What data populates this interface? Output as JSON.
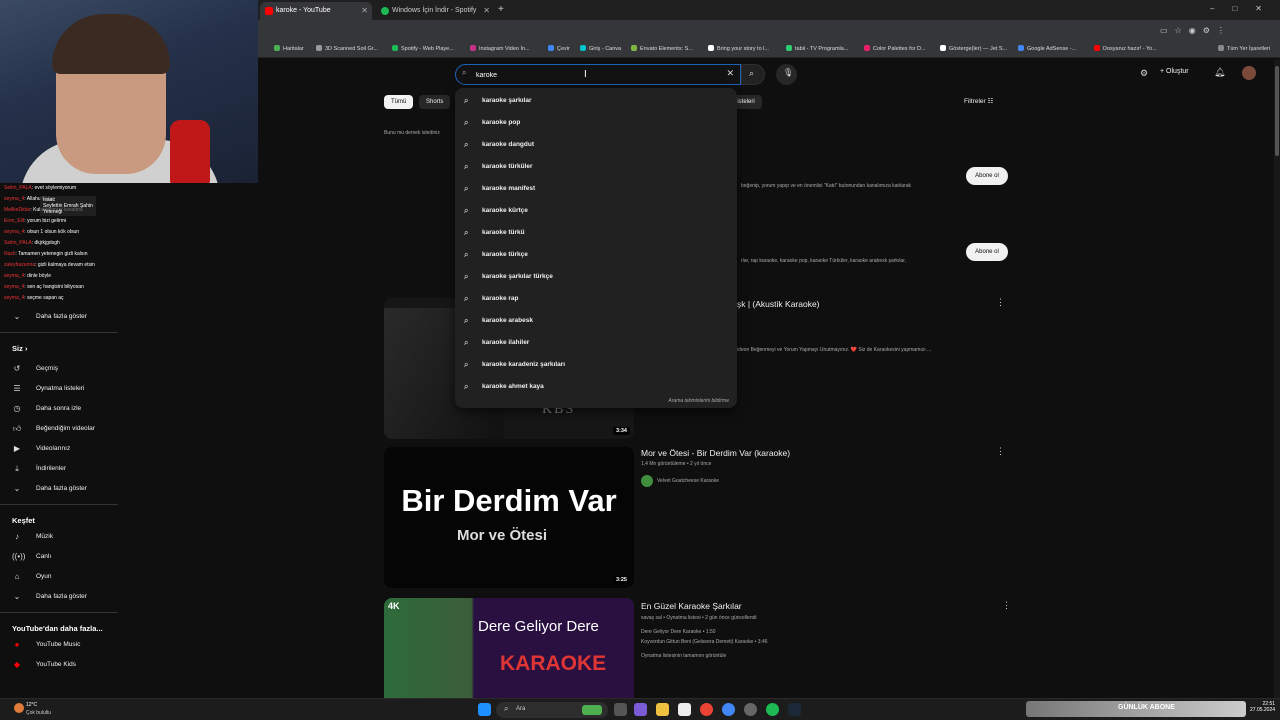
{
  "browser": {
    "tabs": [
      {
        "title": "karoke - YouTube",
        "active": true,
        "favicon_color": "#ff0000"
      },
      {
        "title": "Windows İçin İndir - Spotify",
        "active": false,
        "favicon_color": "#1db954"
      }
    ],
    "new_tab_icon": "plus-icon",
    "bookmarks": [
      "Haritalar",
      "3D Scanned Soil Gr...",
      "Spotify - Web Playe...",
      "Instagram Video İn...",
      "Çevir",
      "Giriş - Canva",
      "Envato Elements: S...",
      "Bring your story to l...",
      "tabii - TV Programla...",
      "Color Palettes for D...",
      "Gösterge(ler) — Jet S...",
      "Google AdSense -...",
      "Dosyanız hazır! - Yo...",
      "Tüm Yer İşaretleri"
    ]
  },
  "youtube": {
    "search_value": "karoke",
    "header": {
      "create_label": "Oluştur"
    },
    "chips": [
      "Tümü",
      "Shorts"
    ],
    "chips_partial": "listeleri",
    "filters_label": "Filtreler",
    "did_you_mean": "Bunu mu demek istediniz",
    "suggestions": [
      "karaoke şarkılar",
      "karaoke pop",
      "karaoke dangdut",
      "karaoke türküler",
      "karaoke manifest",
      "karaoke kürtçe",
      "karaoke türkü",
      "karaoke türkçe",
      "karaoke şarkılar türkçe",
      "karaoke rap",
      "karaoke arabesk",
      "karaoke ilahiler",
      "karaoke karadeniz şarkıları",
      "karaoke ahmet kaya"
    ],
    "report_suggestions": "Arama tahminlerini bildirme",
    "channel_rows": [
      {
        "desc": "beğenip, yorum yapıp ve en önemlisi \"Katıl\" butonundan kanalımıza katılarak",
        "button": "Abone ol"
      },
      {
        "desc": "rlar, rap karaoke, karaoke pop, karaoke Türküler, karaoke arabesk şarkılar,",
        "button": "Abone ol"
      }
    ],
    "videos": [
      {
        "title": "şk | (Akustik Karaoke)",
        "meta": "",
        "desc": "ideon Beğenmeyi ve Yorum Yapmayı Unutmayınız. ❤️ Siz de Karaokesini yapmamızı ...",
        "duration": "3:34",
        "thumb_text": "KBS",
        "thumb_sub": ""
      },
      {
        "title": "Mor ve Ötesi - Bir Derdim Var (karaoke)",
        "meta": "1,4 Mn görüntüleme • 2 yıl önce",
        "channel": "Velvet Goatcheese Karaoke",
        "duration": "3:25",
        "thumb_text": "Bir Derdim Var",
        "thumb_sub": "Mor ve Ötesi"
      },
      {
        "title": "En Güzel Karaoke Şarkılar",
        "meta": "savaş sal • Oynatma listesi • 2 gün önce güncellendi",
        "lines": [
          "Dere Geliyor Dere Karaoke • 1:50",
          "Koyverdun Gittun Beni (Gelavera Demeti) Karaoke • 3:46"
        ],
        "full_list": "Oynatma listesinin tamamını görüntüle",
        "thumb_badge": "4K",
        "thumb_text": "Dere Geliyor Dere",
        "thumb_sub": "KARAOKE"
      }
    ]
  },
  "sidebar": {
    "show_more_top": "Daha fazla göster",
    "you_header": "Siz",
    "you_items": [
      {
        "label": "Geçmiş",
        "icon": "history-icon"
      },
      {
        "label": "Oynatma listeleri",
        "icon": "playlist-icon"
      },
      {
        "label": "Daha sonra izle",
        "icon": "clock-icon"
      },
      {
        "label": "Beğendiğim videolar",
        "icon": "thumb-up-icon"
      },
      {
        "label": "Videolarınız",
        "icon": "video-icon"
      },
      {
        "label": "İndirilenler",
        "icon": "download-icon"
      },
      {
        "label": "Daha fazla göster",
        "icon": "chevron-down-icon"
      }
    ],
    "explore_header": "Keşfet",
    "explore_items": [
      {
        "label": "Müzik",
        "icon": "music-icon"
      },
      {
        "label": "Canlı",
        "icon": "live-icon"
      },
      {
        "label": "Oyun",
        "icon": "gamepad-icon"
      },
      {
        "label": "Daha fazla göster",
        "icon": "chevron-down-icon"
      }
    ],
    "more_header": "YouTube'dan daha fazla...",
    "more_items": [
      {
        "label": "YouTube Music",
        "icon": "youtube-music-icon"
      },
      {
        "label": "YouTube Kids",
        "icon": "youtube-kids-icon"
      }
    ]
  },
  "chat": {
    "lines": [
      {
        "user": "Selim_PALA",
        "msg": ": evet söylemiyorum"
      },
      {
        "user": "seyma_4",
        "msg": ": Allahu Ekber"
      },
      {
        "user": "MelikeDidar",
        "msg": ": Kulaklarımızı kanatma"
      },
      {
        "user": "Eren_Elif",
        "msg": ": yorum bizi gelirmi"
      },
      {
        "user": "seyma_4",
        "msg": ": olsun 1 olsun kök olsun"
      },
      {
        "user": "Selim_PALA",
        "msg": ": dkjrkjgdsgh"
      },
      {
        "user": "Nazlı",
        "msg": ": Tamamen yetenegin gizli kalsın"
      },
      {
        "user": "zuleyhazumra",
        "msg": ": gizli kalmaya devam etsin"
      },
      {
        "user": "seyma_4",
        "msg": ": dinle böyle"
      },
      {
        "user": "seyma_4",
        "msg": ": sen aç hangisini biliyosan"
      },
      {
        "user": "seyma_4",
        "msg": ": seçme sapan aç"
      }
    ],
    "popup_name": "Isaac",
    "popup_sub": "Seyfettin Emrah Şahin",
    "popup_line": "Yeteneği"
  },
  "taskbar": {
    "weather": "12°C",
    "weather_sub": "Çok bulutlu",
    "search_label": "Ara",
    "overlay_text": "GÜNLÜK ABONE",
    "time": "22:51",
    "date": "27.05.2024"
  }
}
